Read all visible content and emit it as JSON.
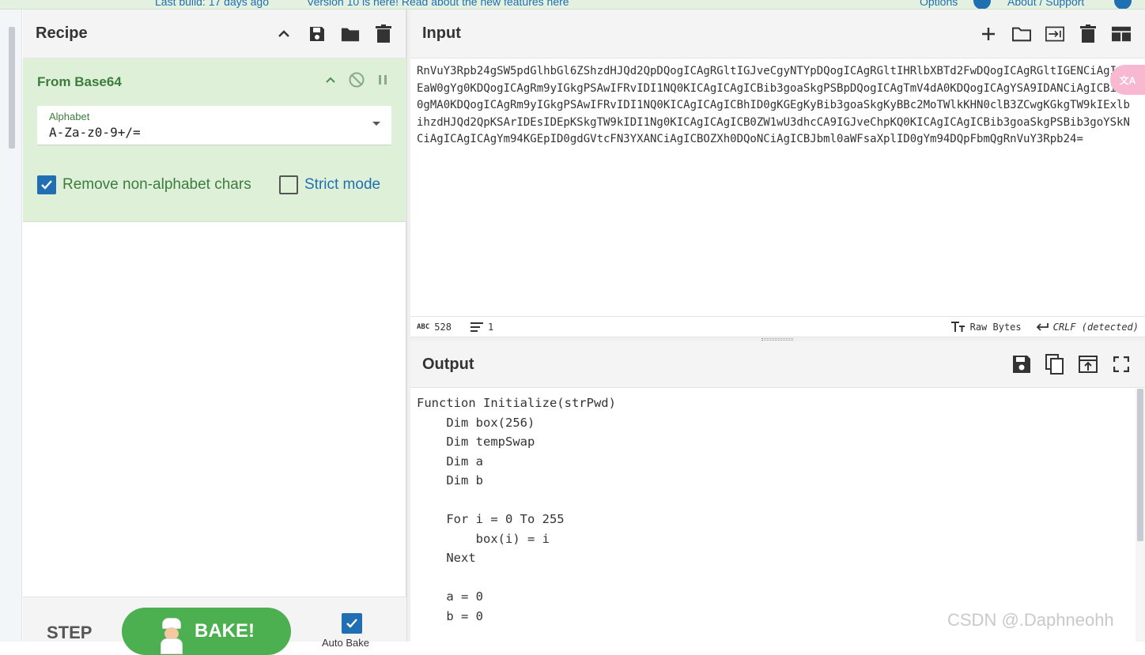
{
  "topbar": {
    "last_build": "Last build: 17 days ago",
    "version_note": "Version 10 is here! Read about the new features here",
    "options": "Options",
    "about": "About / Support"
  },
  "recipe": {
    "title": "Recipe",
    "operation": {
      "name": "From Base64",
      "alphabet_label": "Alphabet",
      "alphabet_value": "A-Za-z0-9+/=",
      "remove_label": "Remove non-alphabet chars",
      "remove_checked": true,
      "strict_label": "Strict mode",
      "strict_checked": false
    },
    "step_label": "STEP",
    "bake_label": "BAKE!",
    "autobake_label": "Auto Bake",
    "autobake_checked": true
  },
  "input": {
    "title": "Input",
    "text": "RnVuY3Rpb24gSW5pdGlhbGl6ZShzdHJQd2QpDQogICAgRGltIGJveCgyNTYpDQogICAgRGltIHRlbXBTd2FwDQogICAgRGltIGENCiAgICBEaW0gYg0KDQogICAgRm9yIGkgPSAwIFRvIDI1NQ0KICAgICAgICBib3goaSkgPSBpDQogICAgTmV4dA0KDQogICAgYSA9IDANCiAgICBiID0gMA0KDQogICAgRm9yIGkgPSAwIFRvIDI1NQ0KICAgICAgICBhID0gKGEgKyBib3goaSkgKyBBc2MoTWlkKHN0clB3ZCwgKGkgTW9kIExlbihzdHJQd2QpKSArIDEsIDEpKSkgTW9kIDI1Ng0KICAgICAgICB0ZW1wU3dhcCA9IGJveChpKQ0KICAgICAgICBib3goaSkgPSBib3goYSkNCiAgICAgICAgYm94KGEpID0gdGVtcFN3YXANCiAgICBOZXh0DQoNCiAgICBJbml0aWFsaXplID0gYm94DQpFbmQgRnVuY3Rpb24=",
    "char_count": "528",
    "line_count": "1",
    "encoding": "Raw Bytes",
    "eol": "CRLF (detected)"
  },
  "output": {
    "title": "Output",
    "text": "Function Initialize(strPwd)\n    Dim box(256)\n    Dim tempSwap\n    Dim a\n    Dim b\n\n    For i = 0 To 255\n        box(i) = i\n    Next\n\n    a = 0\n    b = 0"
  },
  "watermark": "CSDN @.Daphneohh"
}
